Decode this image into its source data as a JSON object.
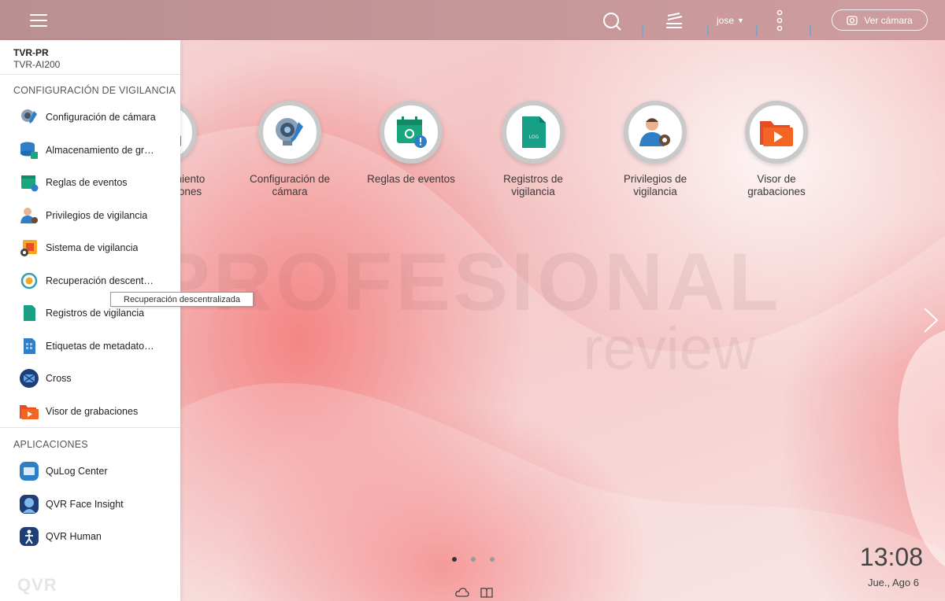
{
  "topbar": {
    "user": "jose",
    "view_camera_label": "Ver cámara"
  },
  "sidebar": {
    "device_name": "TVR-PR",
    "device_model": "TVR-AI200",
    "sections": [
      {
        "title": "CONFIGURACIÓN DE VIGILANCIA",
        "items": [
          {
            "label": "Configuración de cámara",
            "icon": "camera-settings-icon"
          },
          {
            "label": "Almacenamiento de grabaciones",
            "icon": "storage-icon"
          },
          {
            "label": "Reglas de eventos",
            "icon": "event-rules-icon"
          },
          {
            "label": "Privilegios de vigilancia",
            "icon": "privileges-icon"
          },
          {
            "label": "Sistema de vigilancia",
            "icon": "system-icon"
          },
          {
            "label": "Recuperación descentralizada",
            "icon": "recovery-icon"
          },
          {
            "label": "Registros de vigilancia",
            "icon": "logs-icon"
          },
          {
            "label": "Etiquetas de metadatos de vídeo",
            "icon": "metadata-tags-icon"
          },
          {
            "label": "Cross",
            "icon": "cross-icon"
          },
          {
            "label": "Visor de grabaciones",
            "icon": "recording-viewer-icon"
          }
        ]
      },
      {
        "title": "APLICACIONES",
        "items": [
          {
            "label": "QuLog Center",
            "icon": "qulog-icon"
          },
          {
            "label": "QVR Face Insight",
            "icon": "face-insight-icon"
          },
          {
            "label": "QVR Human",
            "icon": "human-icon"
          }
        ]
      }
    ],
    "tooltip": "Recuperación descentralizada",
    "footer_logo": "QVR"
  },
  "desktop": {
    "apps": [
      {
        "label": "Almacenamiento\nde grabaciones",
        "icon": "storage-icon"
      },
      {
        "label": "Configuración de\ncámara",
        "icon": "camera-settings-icon"
      },
      {
        "label": "Reglas de eventos",
        "icon": "event-rules-icon"
      },
      {
        "label": "Registros de\nvigilancia",
        "icon": "logs-icon"
      },
      {
        "label": "Privilegios de\nvigilancia",
        "icon": "privileges-icon"
      },
      {
        "label": "Visor de\ngrabaciones",
        "icon": "recording-viewer-icon"
      }
    ],
    "watermark_line1": "PROFESIONAL",
    "watermark_line2": "review",
    "log_badge": "LOG",
    "page_count": 3,
    "active_page": 1,
    "time": "13:08",
    "date": "Jue., Ago 6"
  },
  "colors": {
    "accent_blue": "#2f7fc7",
    "teal": "#19a77e",
    "orange": "#f26522"
  }
}
